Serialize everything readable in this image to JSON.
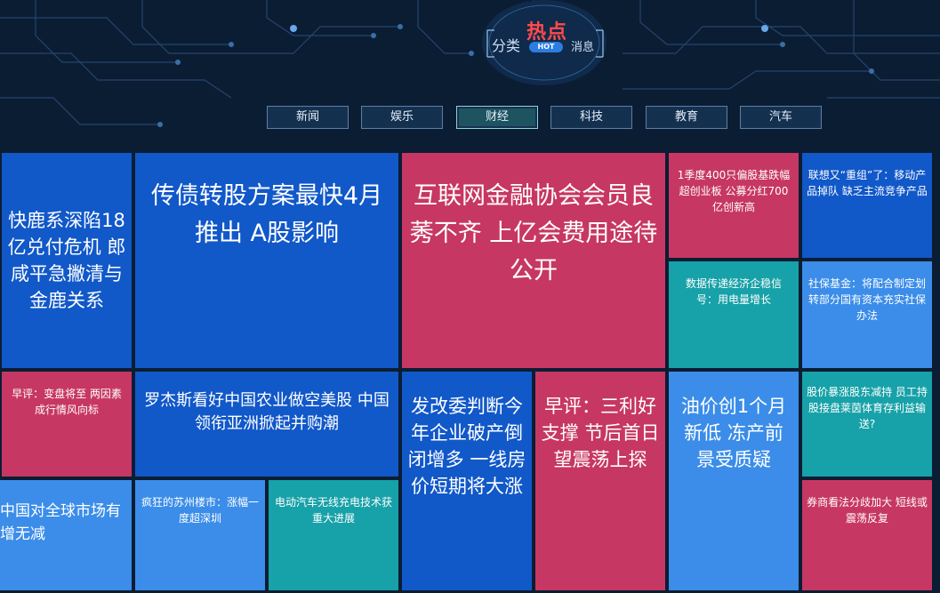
{
  "header": {
    "title_left": "分类",
    "title_hot": "热点",
    "title_badge": "HOT",
    "title_right": "消息"
  },
  "nav": [
    {
      "label": "新闻",
      "active": false
    },
    {
      "label": "娱乐",
      "active": false
    },
    {
      "label": "财经",
      "active": true
    },
    {
      "label": "科技",
      "active": false
    },
    {
      "label": "教育",
      "active": false
    },
    {
      "label": "汽车",
      "active": false
    }
  ],
  "colors": {
    "background": "#0b1d33",
    "blue": "#1158c9",
    "light_blue": "#3b8de9",
    "red": "#c73763",
    "teal": "#17a1a8",
    "hot": "#ff4b4b"
  },
  "tiles": [
    {
      "text": "快鹿系深陷18亿兑付危机 郎咸平急撇清与金鹿关系",
      "color": "blue"
    },
    {
      "text": "传债转股方案最快4月推出 A股影响",
      "color": "blue"
    },
    {
      "text": "互联网金融协会会员良莠不齐 上亿会费用途待公开",
      "color": "red"
    },
    {
      "text": "1季度400只偏股基跌幅超创业板 公募分红700亿创新高",
      "color": "red"
    },
    {
      "text": "联想又“重组”了：移动产品掉队 缺乏主流竞争产品",
      "color": "blue"
    },
    {
      "text": "数据传递经济企稳信号：用电量增长",
      "color": "teal"
    },
    {
      "text": "社保基金：将配合制定划转部分国有资本充实社保办法",
      "color": "light"
    },
    {
      "text": "早评：变盘将至 两因素成行情风向标",
      "color": "red"
    },
    {
      "text": "罗杰斯看好中国农业做空美股 中国领衔亚洲掀起并购潮",
      "color": "blue"
    },
    {
      "text": "发改委判断今年企业破产倒闭增多 一线房价短期将大涨",
      "color": "blue"
    },
    {
      "text": "早评：三利好支撑 节后首日望震荡上探",
      "color": "red"
    },
    {
      "text": "油价创1个月新低 冻产前景受质疑",
      "color": "light"
    },
    {
      "text": "股价暴涨股东减持 员工持股接盘莱茵体育存利益输送?",
      "color": "teal"
    },
    {
      "text": "中国对全球市场有增无减",
      "color": "light"
    },
    {
      "text": "疯狂的苏州楼市：涨幅一度超深圳",
      "color": "light"
    },
    {
      "text": "电动汽车无线充电技术获重大进展",
      "color": "teal"
    },
    {
      "text": "券商看法分歧加大 短线或震荡反复",
      "color": "red"
    }
  ]
}
